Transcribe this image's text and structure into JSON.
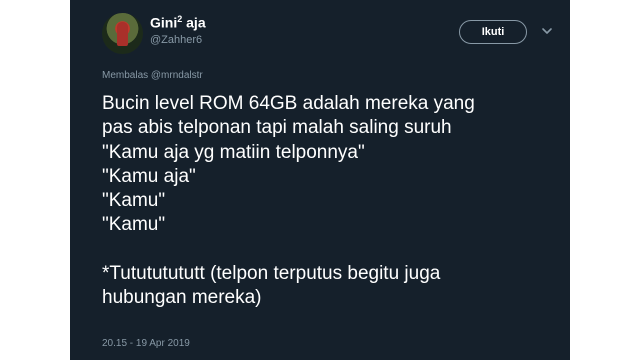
{
  "author": {
    "display_name": "Gini",
    "display_name_sup": "2",
    "display_name_suffix": " aja",
    "handle": "@Zahher6"
  },
  "follow_button": {
    "label": "Ikuti"
  },
  "icons": {
    "avatar": "profile-photo",
    "menu": "chevron-down-icon"
  },
  "reply": {
    "prefix": "Membalas ",
    "mention": "@mrndalstr"
  },
  "tweet": {
    "lines": [
      "Bucin level ROM 64GB adalah mereka yang",
      "pas abis telponan tapi malah saling suruh",
      "\"Kamu aja yg matiin telponnya\"",
      "\"Kamu aja\"",
      "\"Kamu\"",
      "\"Kamu\"",
      "",
      "*Tutututututt (telpon terputus begitu juga",
      "hubungan mereka)"
    ]
  },
  "timestamp": "20.15 - 19 Apr 2019",
  "colors": {
    "background": "#15202b",
    "text": "#ffffff",
    "secondary_text": "#8899a6"
  }
}
